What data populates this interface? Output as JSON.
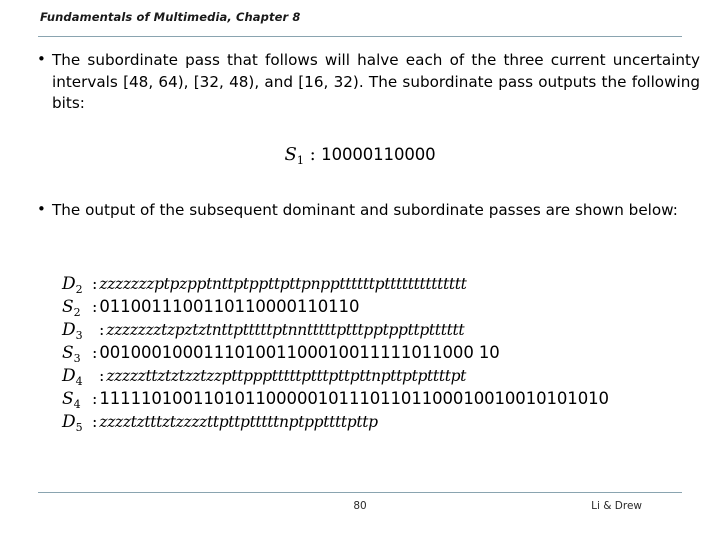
{
  "header": {
    "title": "Fundamentals of Multimedia, Chapter 8",
    "rule_color": "#8aa4b0"
  },
  "content": {
    "bullet_1": "The subordinate pass that follows will halve each of the three current uncertainty intervals [48, 64), [32, 48), and [16, 32).  The subordinate pass outputs the following bits:",
    "bullet_2": "The output of the subsequent dominant and subordinate passes are shown below:",
    "s1_label": "S",
    "s1_sub": "1",
    "s1_sep": ":",
    "s1_value": "10000110000"
  },
  "sequences": [
    {
      "label": "D",
      "sub": "2",
      "sep": ":",
      "sep_wide": false,
      "kind": "symbols",
      "value": "zzzzzzzptpzpptnttptppttpttpnppttttttptttttttttttttt"
    },
    {
      "label": "S",
      "sub": "2",
      "sep": ":",
      "sep_wide": false,
      "kind": "bits",
      "value": "0110011100110110000110110"
    },
    {
      "label": "D",
      "sub": "3",
      "sep": ":",
      "sep_wide": true,
      "kind": "symbols",
      "value": "zzzzzzztzpztztnttptttttptnntttttptttpptppttptttttt"
    },
    {
      "label": "S",
      "sub": "3",
      "sep": ":",
      "sep_wide": false,
      "kind": "bits",
      "value": "001000100011101001100010011111011000 10"
    },
    {
      "label": "D",
      "sub": "4",
      "sep": ":",
      "sep_wide": true,
      "kind": "symbols",
      "value": "zzzzzttztztzztzzpttppptttttptttpttpttnpttptpttttpt"
    },
    {
      "label": "S",
      "sub": "4",
      "sep": ":",
      "sep_wide": false,
      "kind": "bits",
      "value": "1111101001101011000001011101101100010010010101010"
    },
    {
      "label": "D",
      "sub": "5",
      "sep": ":",
      "sep_wide": false,
      "kind": "symbols",
      "value": "zzzztztttztzzzzttpttptttttnptppttttpttp"
    }
  ],
  "footer": {
    "page_number": "80",
    "credit": "Li & Drew",
    "rule_color": "#8aa4b0"
  }
}
